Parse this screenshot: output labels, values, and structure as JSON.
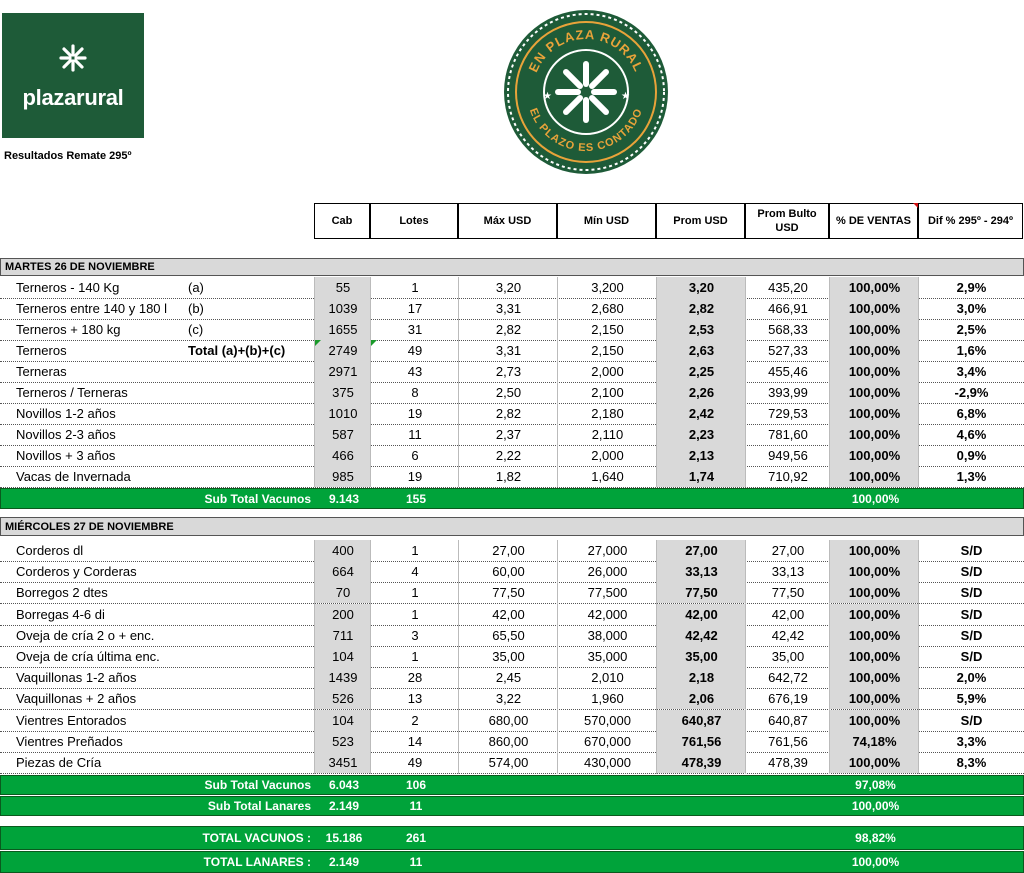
{
  "brand": {
    "name": "plazarural",
    "report_title": "Resultados Remate 295º"
  },
  "seal": {
    "top_text": "EN PLAZA RURAL",
    "bottom_text": "EL PLAZO ES CONTADO"
  },
  "headers": {
    "cab": "Cab",
    "lotes": "Lotes",
    "max": "Máx USD",
    "min": "Mín USD",
    "prom": "Prom USD",
    "bulto": "Prom Bulto USD",
    "ventas": "% DE VENTAS",
    "dif": "Dif % 295º - 294º"
  },
  "section1": {
    "title": "MARTES 26 DE NOVIEMBRE",
    "rows": [
      {
        "cat": "Terneros - 140 Kg",
        "tag": "(a)",
        "cab": "55",
        "lotes": "1",
        "max": "3,20",
        "min": "3,200",
        "prom": "3,20",
        "bulto": "435,20",
        "ventas": "100,00%",
        "dif": "2,9%"
      },
      {
        "cat": "Terneros entre 140 y 180 l",
        "tag": "(b)",
        "cab": "1039",
        "lotes": "17",
        "max": "3,31",
        "min": "2,680",
        "prom": "2,82",
        "bulto": "466,91",
        "ventas": "100,00%",
        "dif": "3,0%"
      },
      {
        "cat": "Terneros + 180 kg",
        "tag": "(c)",
        "cab": "1655",
        "lotes": "31",
        "max": "2,82",
        "min": "2,150",
        "prom": "2,53",
        "bulto": "568,33",
        "ventas": "100,00%",
        "dif": "2,5%"
      },
      {
        "cat": "Terneros",
        "tag": "Total (a)+(b)+(c)",
        "cab": "2749",
        "lotes": "49",
        "max": "3,31",
        "min": "2,150",
        "prom": "2,63",
        "bulto": "527,33",
        "ventas": "100,00%",
        "dif": "1,6%"
      },
      {
        "cat": "Terneras",
        "tag": "",
        "cab": "2971",
        "lotes": "43",
        "max": "2,73",
        "min": "2,000",
        "prom": "2,25",
        "bulto": "455,46",
        "ventas": "100,00%",
        "dif": "3,4%"
      },
      {
        "cat": "Terneros / Terneras",
        "tag": "",
        "cab": "375",
        "lotes": "8",
        "max": "2,50",
        "min": "2,100",
        "prom": "2,26",
        "bulto": "393,99",
        "ventas": "100,00%",
        "dif": "-2,9%"
      },
      {
        "cat": "Novillos 1-2 años",
        "tag": "",
        "cab": "1010",
        "lotes": "19",
        "max": "2,82",
        "min": "2,180",
        "prom": "2,42",
        "bulto": "729,53",
        "ventas": "100,00%",
        "dif": "6,8%"
      },
      {
        "cat": "Novillos 2-3 años",
        "tag": "",
        "cab": "587",
        "lotes": "11",
        "max": "2,37",
        "min": "2,110",
        "prom": "2,23",
        "bulto": "781,60",
        "ventas": "100,00%",
        "dif": "4,6%"
      },
      {
        "cat": "Novillos + 3 años",
        "tag": "",
        "cab": "466",
        "lotes": "6",
        "max": "2,22",
        "min": "2,000",
        "prom": "2,13",
        "bulto": "949,56",
        "ventas": "100,00%",
        "dif": "0,9%"
      },
      {
        "cat": "Vacas de Invernada",
        "tag": "",
        "cab": "985",
        "lotes": "19",
        "max": "1,82",
        "min": "1,640",
        "prom": "1,74",
        "bulto": "710,92",
        "ventas": "100,00%",
        "dif": "1,3%"
      }
    ],
    "subtotal": {
      "label": "Sub Total Vacunos",
      "cab": "9.143",
      "lotes": "155",
      "ventas": "100,00%"
    }
  },
  "section2": {
    "title": "MIÉRCOLES 27 DE NOVIEMBRE",
    "rows": [
      {
        "cat": "Corderos dl",
        "cab": "400",
        "lotes": "1",
        "max": "27,00",
        "min": "27,000",
        "prom": "27,00",
        "bulto": "27,00",
        "ventas": "100,00%",
        "dif": "S/D"
      },
      {
        "cat": "Corderos y Corderas",
        "cab": "664",
        "lotes": "4",
        "max": "60,00",
        "min": "26,000",
        "prom": "33,13",
        "bulto": "33,13",
        "ventas": "100,00%",
        "dif": "S/D"
      },
      {
        "cat": "Borregos 2 dtes",
        "cab": "70",
        "lotes": "1",
        "max": "77,50",
        "min": "77,500",
        "prom": "77,50",
        "bulto": "77,50",
        "ventas": "100,00%",
        "dif": "S/D"
      },
      {
        "cat": "Borregas 4-6 di",
        "cab": "200",
        "lotes": "1",
        "max": "42,00",
        "min": "42,000",
        "prom": "42,00",
        "bulto": "42,00",
        "ventas": "100,00%",
        "dif": "S/D"
      },
      {
        "cat": "Oveja de cría 2 o + enc.",
        "cab": "711",
        "lotes": "3",
        "max": "65,50",
        "min": "38,000",
        "prom": "42,42",
        "bulto": "42,42",
        "ventas": "100,00%",
        "dif": "S/D"
      },
      {
        "cat": "Oveja de cría última enc.",
        "cab": "104",
        "lotes": "1",
        "max": "35,00",
        "min": "35,000",
        "prom": "35,00",
        "bulto": "35,00",
        "ventas": "100,00%",
        "dif": "S/D"
      },
      {
        "cat": "Vaquillonas 1-2 años",
        "cab": "1439",
        "lotes": "28",
        "max": "2,45",
        "min": "2,010",
        "prom": "2,18",
        "bulto": "642,72",
        "ventas": "100,00%",
        "dif": "2,0%"
      },
      {
        "cat": "Vaquillonas + 2 años",
        "cab": "526",
        "lotes": "13",
        "max": "3,22",
        "min": "1,960",
        "prom": "2,06",
        "bulto": "676,19",
        "ventas": "100,00%",
        "dif": "5,9%"
      },
      {
        "cat": "Vientres Entorados",
        "cab": "104",
        "lotes": "2",
        "max": "680,00",
        "min": "570,000",
        "prom": "640,87",
        "bulto": "640,87",
        "ventas": "100,00%",
        "dif": "S/D"
      },
      {
        "cat": "Vientres Preñados",
        "cab": "523",
        "lotes": "14",
        "max": "860,00",
        "min": "670,000",
        "prom": "761,56",
        "bulto": "761,56",
        "ventas": "74,18%",
        "dif": "3,3%"
      },
      {
        "cat": "Piezas de Cría",
        "cab": "3451",
        "lotes": "49",
        "max": "574,00",
        "min": "430,000",
        "prom": "478,39",
        "bulto": "478,39",
        "ventas": "100,00%",
        "dif": "8,3%"
      }
    ],
    "subtotal_vacunos": {
      "label": "Sub Total Vacunos",
      "cab": "6.043",
      "lotes": "106",
      "ventas": "97,08%"
    },
    "subtotal_lanares": {
      "label": "Sub Total Lanares",
      "cab": "2.149",
      "lotes": "11",
      "ventas": "100,00%"
    }
  },
  "totals": {
    "vacunos": {
      "label": "TOTAL VACUNOS :",
      "cab": "15.186",
      "lotes": "261",
      "ventas": "98,82%"
    },
    "lanares": {
      "label": "TOTAL LANARES :",
      "cab": "2.149",
      "lotes": "11",
      "ventas": "100,00%"
    }
  },
  "colors": {
    "brand_green": "#1e5b38",
    "total_green": "#00a33a",
    "section_gray": "#d9d9d9"
  }
}
